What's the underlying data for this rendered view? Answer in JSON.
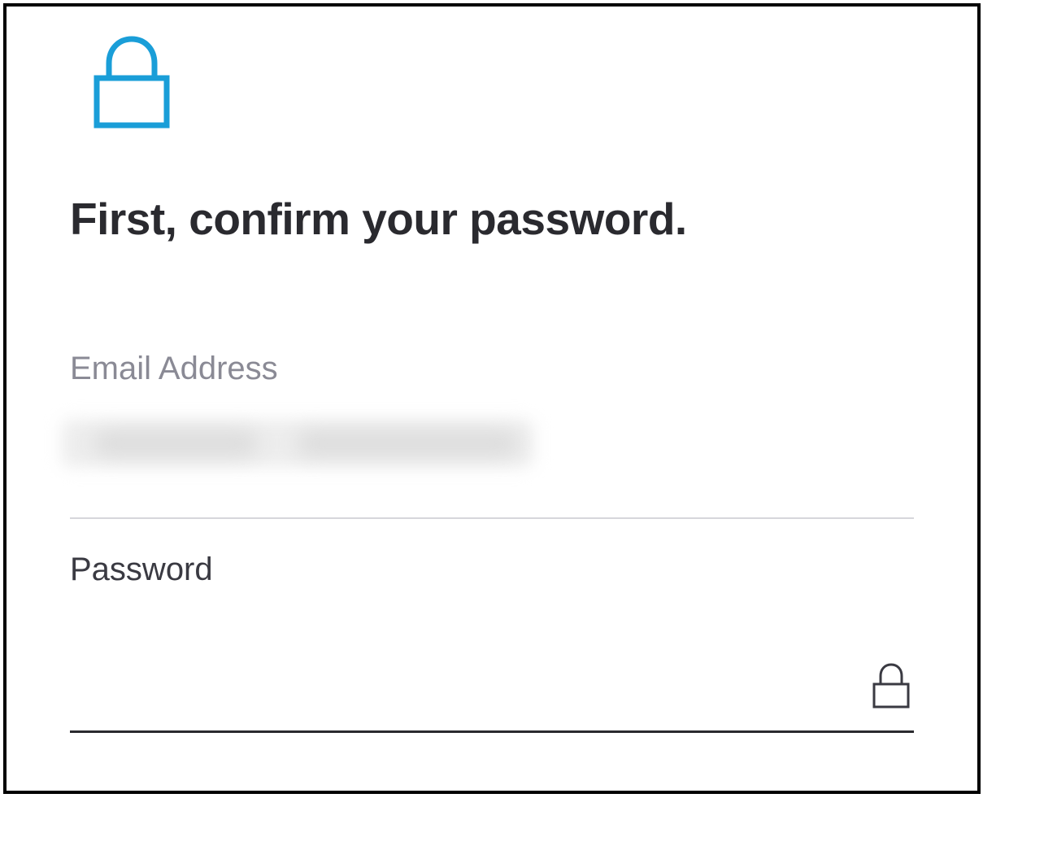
{
  "header": {
    "icon_name": "lock-icon",
    "icon_color": "#1a9ed8"
  },
  "title": "First, confirm your password.",
  "email": {
    "label": "Email Address",
    "value_redacted": true
  },
  "password": {
    "label": "Password",
    "value": "",
    "placeholder": "",
    "icon_name": "lock-icon",
    "icon_color": "#3a3a42"
  }
}
